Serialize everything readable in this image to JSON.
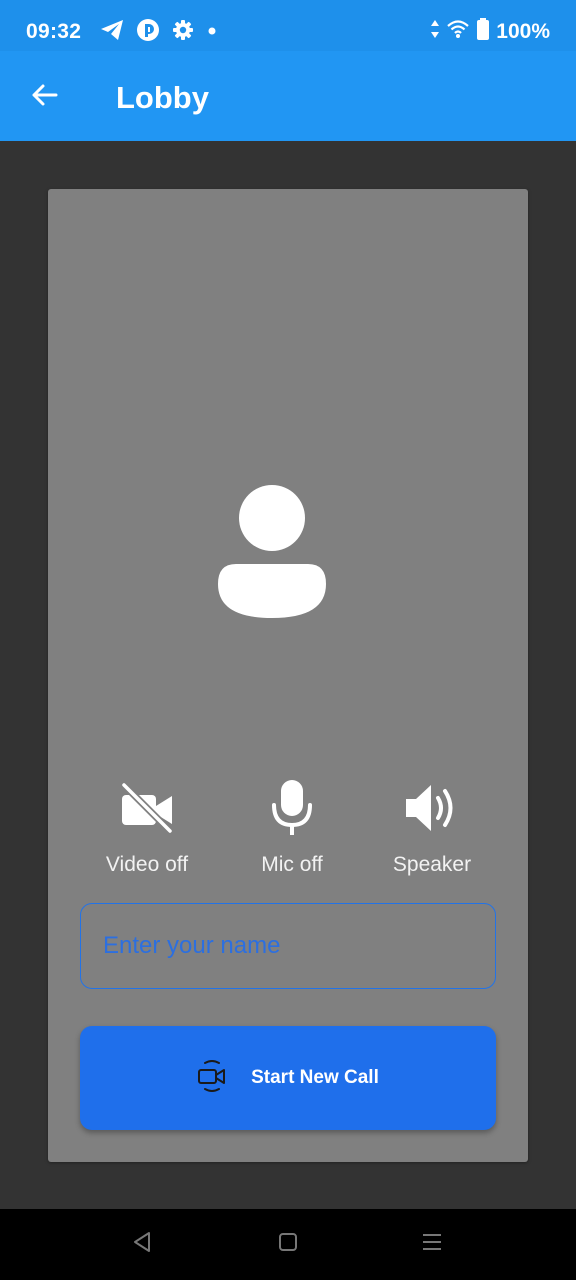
{
  "status_bar": {
    "time": "09:32",
    "battery": "100%",
    "icons": [
      "telegram-icon",
      "app-icon",
      "settings-icon",
      "dot-icon",
      "data-arrows-icon",
      "wifi-icon",
      "battery-icon"
    ]
  },
  "app_bar": {
    "title": "Lobby",
    "back_icon": "arrow-back-icon"
  },
  "preview": {
    "avatar_icon": "person-icon"
  },
  "controls": [
    {
      "label": "Video off",
      "icon": "video-off-icon"
    },
    {
      "label": "Mic off",
      "icon": "mic-icon"
    },
    {
      "label": "Speaker",
      "icon": "speaker-icon"
    }
  ],
  "name_input": {
    "value": "",
    "placeholder": "Enter your name"
  },
  "start_button": {
    "label": "Start New Call",
    "icon": "video-call-icon"
  },
  "nav_bar": {
    "icons": [
      "back-triangle-icon",
      "home-square-icon",
      "menu-lines-icon"
    ]
  },
  "colors": {
    "status_bar": "#1e90eb",
    "app_bar": "#2196f3",
    "background": "#333333",
    "card": "#808080",
    "accent": "#1f6feb"
  }
}
